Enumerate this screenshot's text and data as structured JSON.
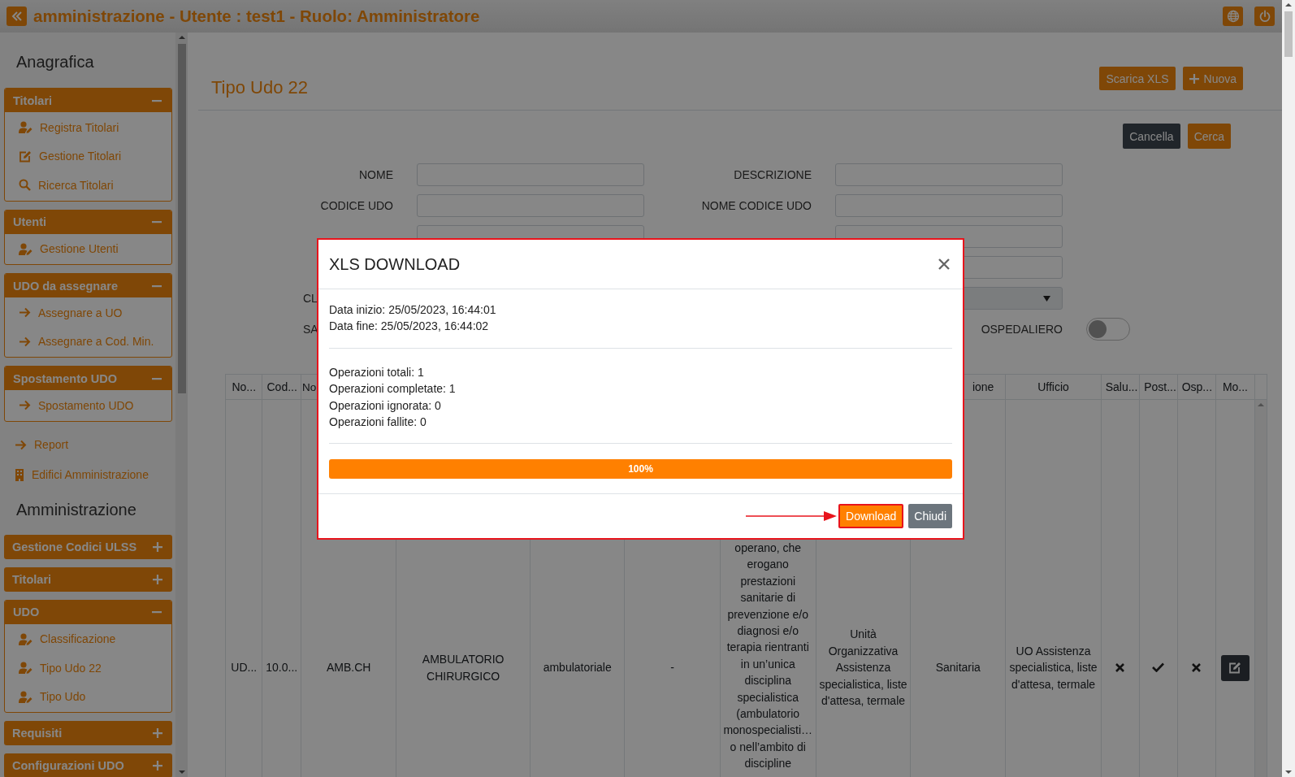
{
  "header": {
    "title": "amministrazione - Utente : test1 - Ruolo: Amministratore"
  },
  "sidebar": {
    "groups": [
      {
        "heading": "Anagrafica",
        "entries": [
          {
            "kind": "section",
            "title": "Titolari",
            "expanded": true,
            "items": [
              {
                "label": "Registra Titolari"
              },
              {
                "label": "Gestione Titolari"
              },
              {
                "label": "Ricerca Titolari"
              }
            ]
          },
          {
            "kind": "section",
            "title": "Utenti",
            "expanded": true,
            "items": [
              {
                "label": "Gestione Utenti"
              }
            ]
          },
          {
            "kind": "section",
            "title": "UDO da assegnare",
            "expanded": true,
            "items": [
              {
                "label": "Assegnare a UO"
              },
              {
                "label": "Assegnare a Cod. Min."
              }
            ]
          },
          {
            "kind": "section",
            "title": "Spostamento UDO",
            "expanded": true,
            "items": [
              {
                "label": "Spostamento UDO"
              }
            ]
          },
          {
            "kind": "link",
            "label": "Report"
          },
          {
            "kind": "link",
            "label": "Edifici Amministrazione"
          }
        ]
      },
      {
        "heading": "Amministrazione",
        "entries": [
          {
            "kind": "section",
            "title": "Gestione Codici ULSS",
            "expanded": false
          },
          {
            "kind": "section",
            "title": "Titolari",
            "expanded": false
          },
          {
            "kind": "section",
            "title": "UDO",
            "expanded": true,
            "items": [
              {
                "label": "Classificazione"
              },
              {
                "label": "Tipo Udo 22"
              },
              {
                "label": "Tipo Udo"
              }
            ]
          },
          {
            "kind": "section",
            "title": "Requisiti",
            "expanded": false
          },
          {
            "kind": "section",
            "title": "Configurazioni UDO",
            "expanded": false
          }
        ]
      }
    ]
  },
  "page": {
    "title": "Tipo Udo 22",
    "actions": [
      {
        "label": "Scarica XLS"
      },
      {
        "label": "Nuova"
      }
    ],
    "form_buttons": [
      {
        "label": "Cancella",
        "kind": "secondary"
      },
      {
        "label": "Cerca",
        "kind": "primary"
      }
    ]
  },
  "form": {
    "rows": [
      {
        "left": {
          "label": "NOME",
          "kind": "text"
        },
        "right": {
          "label": "DESCRIZIONE",
          "kind": "text"
        }
      },
      {
        "left": {
          "label": "CODICE UDO",
          "kind": "text"
        },
        "right": {
          "label": "NOME CODICE UDO",
          "kind": "text"
        }
      },
      {
        "left": {
          "kind": "text"
        },
        "right": {
          "kind": "text"
        }
      },
      {
        "right": {
          "kind": "text"
        }
      },
      {
        "left": {
          "label": "CL",
          "kind": "label"
        },
        "right": {
          "kind": "select"
        }
      },
      {
        "left": {
          "label": "SA",
          "kind": "label"
        },
        "right": {
          "label": "OSPEDALIERO",
          "kind": "toggle",
          "on": false
        }
      }
    ]
  },
  "table": {
    "columns": [
      {
        "label": "No..."
      },
      {
        "label": "Cod..."
      },
      {
        "label": "No"
      },
      {},
      {},
      {},
      {},
      {},
      {
        "label": "ione"
      },
      {
        "label": "Ufficio"
      },
      {
        "label": "Salu..."
      },
      {
        "label": "Post..."
      },
      {
        "label": "Osp..."
      },
      {
        "label": "Mo..."
      }
    ],
    "rows": [
      {
        "cells": [
          {
            "kind": "text",
            "text": "UD..."
          },
          {
            "kind": "text",
            "text": "10.0..."
          },
          {
            "kind": "text",
            "text": "AMB.CH"
          },
          {
            "kind": "text",
            "text": "AMBULATORIO\nCHIRURGICO"
          },
          {
            "kind": "text",
            "text": "ambulatoriale"
          },
          {
            "kind": "text",
            "text": "-"
          },
          {
            "kind": "longtext",
            "text": "operano, che\nerogano\nprestazioni\nsanitarie di\nprevenzione e/o\ndiagnosi e/o\nterapia rientranti\nin un’unica\ndisciplina\nspecialistica\n(ambulatorio\nmonospecialisti…\no nell’ambito di\ndiscipline"
          },
          {
            "kind": "text",
            "text": "Unità\nOrganizzativa\nAssistenza\nspecialistica, liste\nd'attesa, termale"
          },
          {
            "kind": "text",
            "text": "Sanitaria"
          },
          {
            "kind": "text",
            "text": "UO Assistenza\nspecialistica, liste\nd'attesa, termale"
          },
          {
            "kind": "flag",
            "on": false
          },
          {
            "kind": "flag",
            "on": true
          },
          {
            "kind": "flag",
            "on": false
          },
          {
            "kind": "edit"
          }
        ]
      }
    ]
  },
  "modal": {
    "title": "XLS DOWNLOAD",
    "highlighted": true,
    "info": [
      "Data inizio: 25/05/2023, 16:44:01",
      "Data fine: 25/05/2023, 16:44:02"
    ],
    "stats": [
      "Operazioni totali: 1",
      "Operazioni completate: 1",
      "Operazioni ignorata: 0",
      "Operazioni fallite: 0"
    ],
    "progress": {
      "level": 1,
      "label": "100%"
    },
    "buttons": [
      {
        "label": "Download",
        "kind": "primary",
        "highlighted": true
      },
      {
        "label": "Chiudi",
        "kind": "secondary",
        "highlighted": false
      }
    ]
  }
}
